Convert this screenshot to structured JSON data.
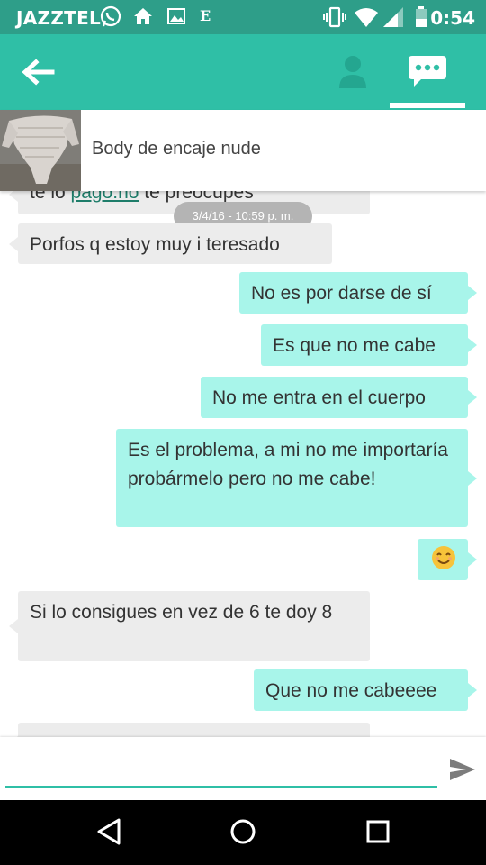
{
  "status_bar": {
    "carrier": "JAZZTEL",
    "time": "0:54",
    "left_icons": [
      "whatsapp-icon",
      "home-icon",
      "image-icon",
      "e-icon"
    ],
    "e_glyph": "E",
    "right_icons": [
      "vibrate-icon",
      "wifi-icon",
      "signal-icon",
      "battery-icon"
    ],
    "color": "#2e9e89"
  },
  "app_bar": {
    "back_icon": "back-arrow-icon",
    "tabs": [
      "profile-icon",
      "chat-bubble-icon"
    ],
    "active_tab": "chat-bubble-icon",
    "color": "#2fbfa6"
  },
  "product": {
    "title": "Body de encaje nude",
    "thumbnail_icon": "lace-bodysuit-thumbnail"
  },
  "messages": [
    {
      "from": "other",
      "text_before": "te lo ",
      "link": "pago.no",
      "text_after": " te preocupes"
    },
    {
      "from": "other",
      "text": "Porfos q estoy muy i teresado"
    },
    {
      "from": "me",
      "text": "No es por darse de sí"
    },
    {
      "from": "me",
      "text": "Es que no me cabe"
    },
    {
      "from": "me",
      "text": "No me entra en el cuerpo"
    },
    {
      "from": "me",
      "text": "Es el problema, a mi no me importaría probármelo pero no me cabe!"
    },
    {
      "from": "me",
      "emoji": "smiling-face-emoji"
    },
    {
      "from": "other",
      "text": "Si lo consigues en vez de 6 te doy 8"
    },
    {
      "from": "me",
      "text": "Que no me cabeeee"
    },
    {
      "from": "other",
      "text": ""
    }
  ],
  "timestamp": "3/4/16 - 10:59 p. m.",
  "composer": {
    "placeholder": "",
    "value": "",
    "send_icon": "send-icon"
  },
  "nav_bar": [
    "back-triangle-icon",
    "home-circle-icon",
    "recents-square-icon"
  ],
  "colors": {
    "sent_bubble": "#a8f5ea",
    "received_bubble": "#ececec",
    "accent": "#2fbfa6"
  }
}
